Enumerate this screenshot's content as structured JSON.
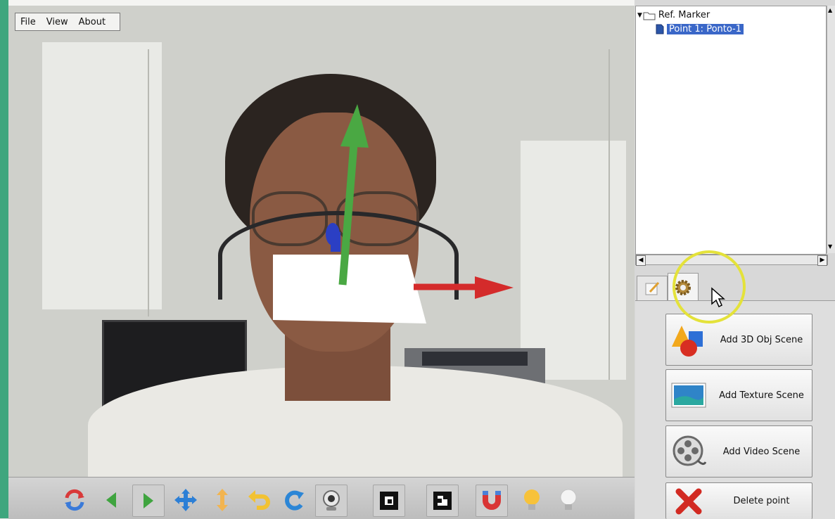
{
  "menu": {
    "items": [
      "File",
      "View",
      "About"
    ]
  },
  "tree": {
    "root_label": "Ref. Marker",
    "child_label": "Point 1: Ponto-1"
  },
  "tabs": [
    {
      "icon": "edit-icon"
    },
    {
      "icon": "gear-icon"
    }
  ],
  "actions": {
    "add_3d_obj": "Add 3D Obj Scene",
    "add_texture": "Add Texture Scene",
    "add_video": "Add Video Scene",
    "delete_point": "Delete point"
  },
  "toolbar": {
    "tools": [
      "refresh-icon",
      "arrow-left-icon",
      "arrow-right-icon",
      "move-icon",
      "vertical-move-icon",
      "undo-icon",
      "redo-icon",
      "webcam-icon",
      "marker-1-icon",
      "marker-2-icon",
      "magnet-icon",
      "light-on-icon",
      "light-off-icon"
    ]
  },
  "colors": {
    "axis_x": "#d42b2b",
    "axis_y": "#4aa843",
    "axis_z": "#2b3fc4",
    "selection": "#3a67c8",
    "highlight_ring": "#e4e23a"
  }
}
